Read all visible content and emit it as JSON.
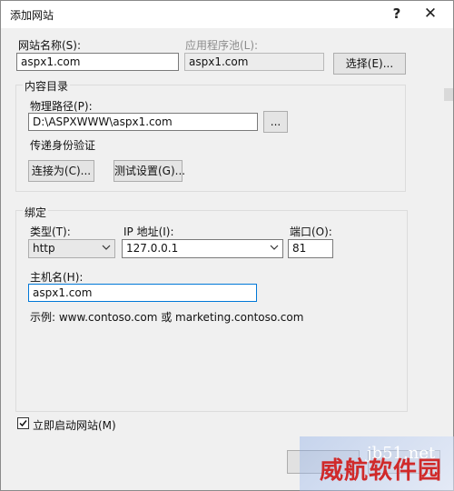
{
  "window": {
    "title": "添加网站",
    "help": "?",
    "close": "✕"
  },
  "site": {
    "name_label": "网站名称(S):",
    "name_value": "aspx1.com",
    "pool_label": "应用程序池(L):",
    "pool_value": "aspx1.com",
    "select_button": "选择(E)..."
  },
  "content": {
    "group_title": "内容目录",
    "path_label": "物理路径(P):",
    "path_value": "D:\\ASPXWWW\\aspx1.com",
    "browse_button": "...",
    "auth_label": "传递身份验证",
    "connect_as_button": "连接为(C)...",
    "test_settings_button": "测试设置(G)..."
  },
  "binding": {
    "group_title": "绑定",
    "type_label": "类型(T):",
    "type_value": "http",
    "ip_label": "IP 地址(I):",
    "ip_value": "127.0.0.1",
    "port_label": "端口(O):",
    "port_value": "81",
    "host_label": "主机名(H):",
    "host_value": "aspx1.com",
    "example": "示例: www.contoso.com 或 marketing.contoso.com"
  },
  "start": {
    "label": "立即启动网站(M)",
    "checked": true
  },
  "watermark": {
    "text": "脚本之家",
    "overlay": "威航软件园",
    "sub": "jb51.net"
  },
  "colors": {
    "watermark_red": "#d02a2a",
    "focus_blue": "#0078d7"
  }
}
